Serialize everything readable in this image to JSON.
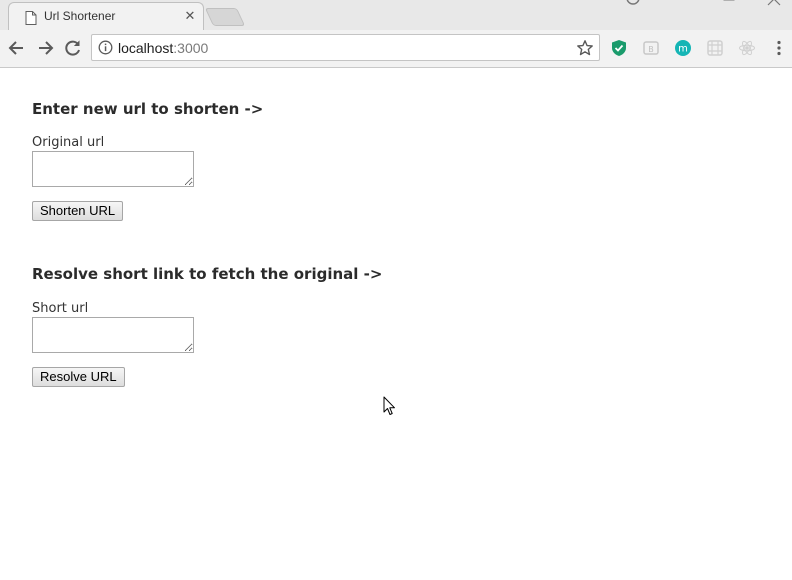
{
  "browser": {
    "tab": {
      "title": "Url Shortener",
      "close_glyph": "✕",
      "icon": "document-icon"
    },
    "address_bar": {
      "host": "localhost",
      "port": ":3000",
      "info_icon": "info-icon",
      "bookmark_icon": "star-icon"
    },
    "nav": {
      "back_icon": "arrow-left-icon",
      "forward_icon": "arrow-right-icon",
      "reload_icon": "reload-icon"
    },
    "extensions": [
      {
        "name": "shield-extension-icon",
        "color": "#1a9b6c"
      },
      {
        "name": "bi-extension-icon",
        "color": "#c8c8c8"
      },
      {
        "name": "m-extension-icon",
        "color": "#15b5b5",
        "text": "m"
      },
      {
        "name": "grid-extension-icon",
        "color": "#d0d0d0"
      },
      {
        "name": "react-extension-icon",
        "color": "#d0d0d0"
      }
    ]
  },
  "shorten_section": {
    "heading": "Enter new url to shorten ->",
    "field_label": "Original url",
    "field_value": "",
    "button_label": "Shorten URL"
  },
  "resolve_section": {
    "heading": "Resolve short link to fetch the original ->",
    "field_label": "Short url",
    "field_value": "",
    "button_label": "Resolve URL"
  },
  "colors": {
    "heading_text": "#2b2b2b",
    "label_text": "#333333",
    "chrome_bg": "#f2f2f2"
  }
}
